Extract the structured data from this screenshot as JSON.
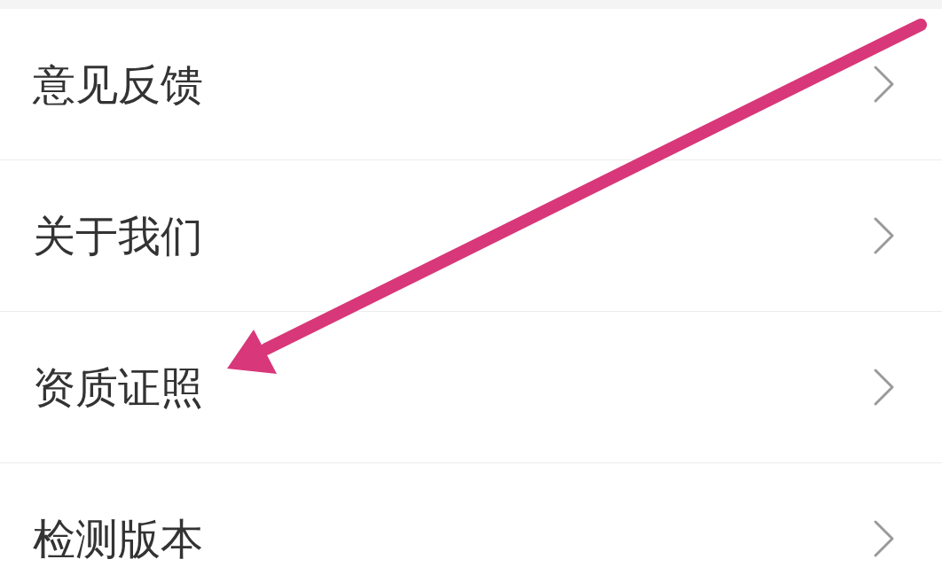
{
  "menu": {
    "items": [
      {
        "label": "意见反馈"
      },
      {
        "label": "关于我们"
      },
      {
        "label": "资质证照"
      },
      {
        "label": "检测版本"
      }
    ]
  }
}
